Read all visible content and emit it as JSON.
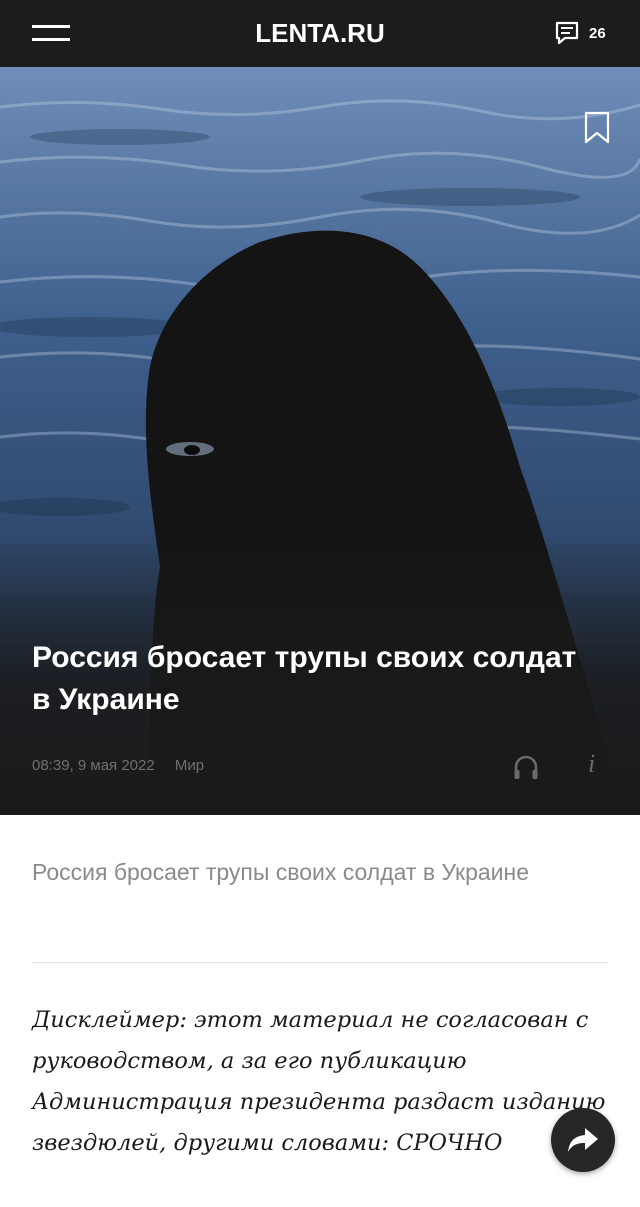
{
  "header": {
    "logo": "LENTA.RU",
    "comments_count": "26"
  },
  "article": {
    "title": "Россия бросает трупы своих солдат в Украине",
    "time": "08:39, 9 мая 2022",
    "category": "Мир",
    "info_symbol": "i",
    "lead": "Россия бросает трупы своих солдат в Украине",
    "body": "Дисклеймер: этот материал не согласован с руководством, а за его публикацию Администрация президента раздаст изданию звездюлей, другими словами: СРОЧНО"
  },
  "icons": {
    "menu": "hamburger-icon",
    "comments": "comment-icon",
    "bookmark": "bookmark-icon",
    "listen": "headphones-icon",
    "info": "info-icon",
    "share": "share-arrow-icon"
  },
  "colors": {
    "header_bg": "#1c1c1c",
    "hero_sea": "#3b5a86",
    "meta_text": "#6f6f6f",
    "lead_text": "#8a8a8a",
    "share_bg": "#262626"
  }
}
